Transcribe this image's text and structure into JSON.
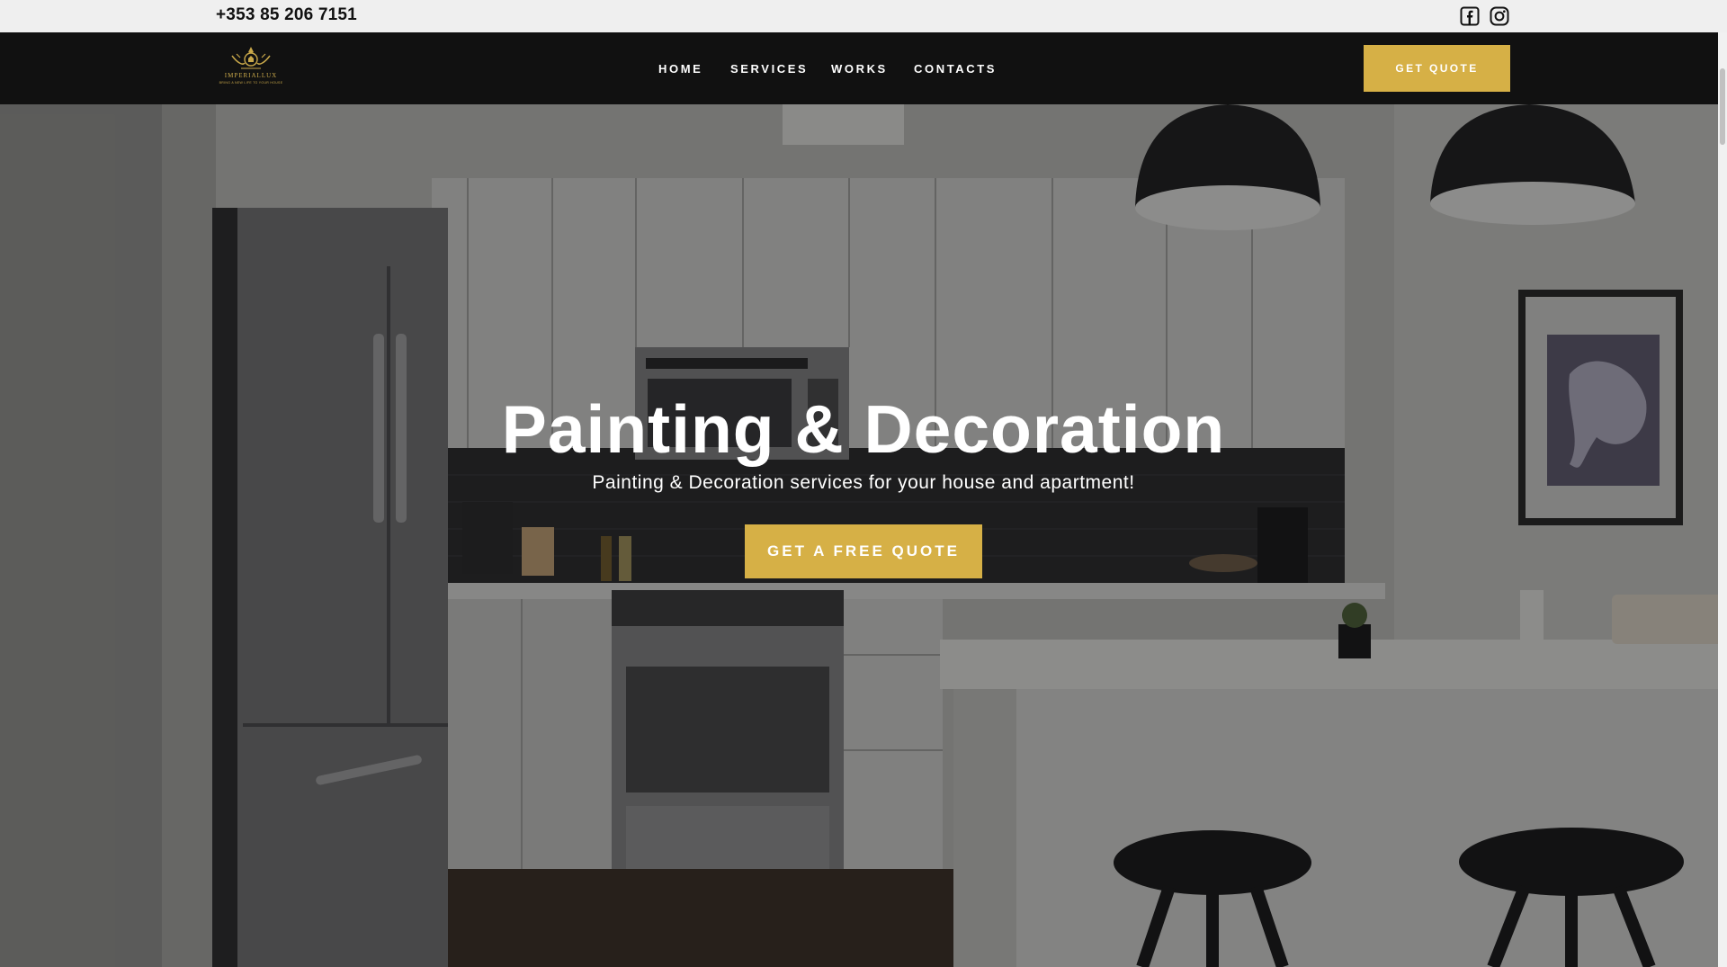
{
  "topbar": {
    "phone": "+353 85 206 7151",
    "social": [
      {
        "name": "facebook-icon",
        "label": "Facebook"
      },
      {
        "name": "instagram-icon",
        "label": "Instagram"
      }
    ]
  },
  "brand": {
    "name": "IMPERIALLUX",
    "tagline": "BRING A NEW LIFE TO YOUR HOUSE",
    "accent": "#d6b046"
  },
  "nav": {
    "items": [
      {
        "label": "HOME"
      },
      {
        "label": "SERVICES"
      },
      {
        "label": "WORKS"
      },
      {
        "label": "CONTACTS"
      }
    ],
    "cta_label": "GET QUOTE"
  },
  "hero": {
    "title": "Painting & Decoration",
    "subtitle": "Painting & Decoration services for your house and apartment!",
    "cta_label": "GET A FREE QUOTE",
    "image": "kitchen-photo"
  },
  "colors": {
    "navbar": "#111111",
    "topbar": "#efefef",
    "accent": "#d6b046",
    "text_light": "#ffffff"
  }
}
